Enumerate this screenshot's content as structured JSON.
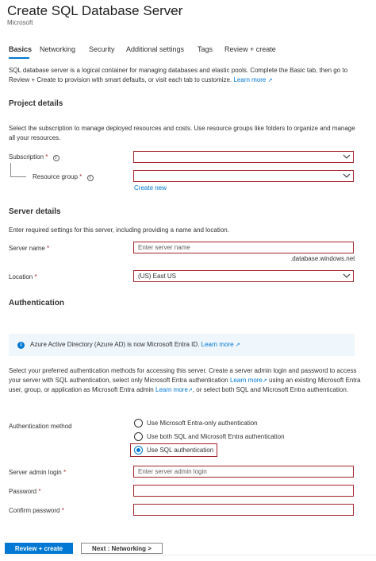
{
  "header": {
    "title": "Create SQL Database Server",
    "more": "···",
    "publisher": "Microsoft"
  },
  "tabs": [
    {
      "label": "Basics",
      "active": true
    },
    {
      "label": "Networking"
    },
    {
      "label": "Security"
    },
    {
      "label": "Additional settings"
    },
    {
      "label": "Tags"
    },
    {
      "label": "Review + create"
    }
  ],
  "intro": {
    "text": "SQL database server is a logical container for managing databases and elastic pools. Complete the Basic tab, then go to Review + Create to provision with smart defaults, or visit each tab to customize.",
    "link": "Learn more",
    "ext": "↗"
  },
  "project": {
    "heading": "Project details",
    "description": "Select the subscription to manage deployed resources and costs. Use resource groups like folders to organize and manage all your resources.",
    "subscription_label": "Subscription",
    "resource_group_label": "Resource group",
    "create_new": "Create new",
    "required": "*",
    "info": "i"
  },
  "server": {
    "heading": "Server details",
    "description": "Enter required settings for this server, including providing a name and location.",
    "name_label": "Server name",
    "name_placeholder": "Enter server name",
    "suffix": ".database.windows.net",
    "location_label": "Location",
    "location_value": "(US) East US"
  },
  "auth": {
    "heading": "Authentication",
    "info_text": "Azure Active Directory (Azure AD) is now Microsoft Entra ID.",
    "info_link": "Learn more",
    "description_1": "Select your preferred authentication methods for accessing this server. Create a server admin login and password to access your server with SQL authentication, select only Microsoft Entra authentication",
    "learn_more_1": "Learn more",
    "description_2": "using an existing Microsoft Entra user, group, or application as Microsoft Entra admin",
    "learn_more_2": "Learn more",
    "description_3": ", or select both SQL and Microsoft Entra authentication.",
    "method_label": "Authentication method",
    "options": [
      "Use Microsoft Entra-only authentication",
      "Use both SQL and Microsoft Entra authentication",
      "Use SQL authentication"
    ],
    "selected_index": 2,
    "admin_label": "Server admin login",
    "admin_placeholder": "Enter server admin login",
    "password_label": "Password",
    "confirm_label": "Confirm password"
  },
  "footer": {
    "review": "Review + create",
    "next": "Next : Networking >"
  },
  "colors": {
    "accent": "#0078d4",
    "error_border": "#a4262c",
    "info_bg": "#eff6fc"
  }
}
